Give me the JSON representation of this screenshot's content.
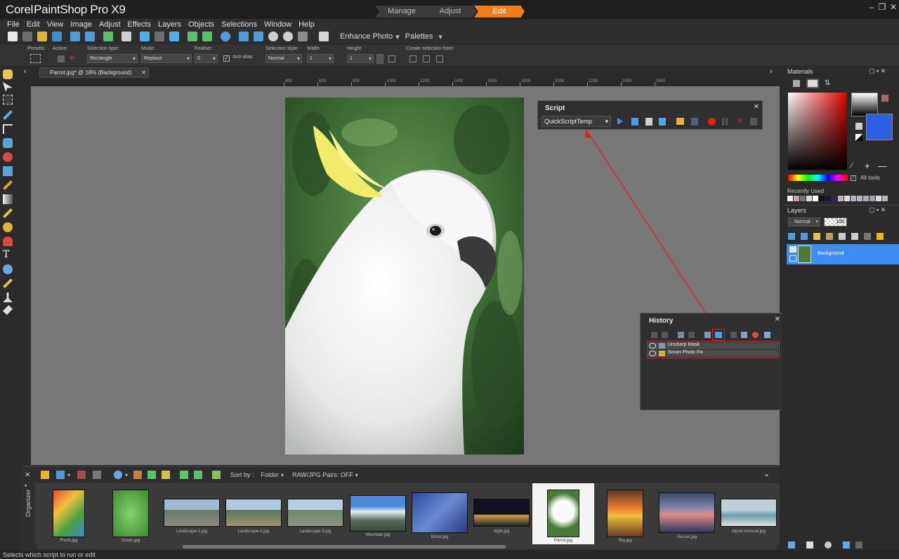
{
  "app": {
    "title_plain": "Corel",
    "title_rest": "PaintShop Pro X9"
  },
  "workspace_tabs": [
    "Manage",
    "Adjust",
    "Edit"
  ],
  "menu": [
    "File",
    "Edit",
    "View",
    "Image",
    "Adjust",
    "Effects",
    "Layers",
    "Objects",
    "Selections",
    "Window",
    "Help"
  ],
  "toolbar": {
    "enhance_label": "Enhance Photo",
    "palettes_label": "Palettes"
  },
  "options": {
    "presets_label": "Presets:",
    "action_label": "Action:",
    "selection_type_label": "Selection type:",
    "selection_type_value": "Rectangle",
    "mode_label": "Mode:",
    "mode_value": "Replace",
    "feather_label": "Feather:",
    "feather_value": "0",
    "antialias_label": "Anti-alias",
    "selection_style_label": "Selection style:",
    "selection_style_value": "Normal",
    "width_label": "Width",
    "width_value": "1",
    "height_label": "Height",
    "height_value": "1",
    "create_from_label": "Create selection from:"
  },
  "document": {
    "tab_label": "Parrot.jpg* @  18% (Background)"
  },
  "ruler_ticks": [
    "200",
    "400",
    "600",
    "800",
    "1000",
    "1200",
    "1400",
    "1600",
    "1800",
    "2000",
    "2200",
    "2400",
    "2600"
  ],
  "script_palette": {
    "title": "Script",
    "script_name": "QuickScriptTemp"
  },
  "history": {
    "title": "History",
    "items": [
      "Unsharp Mask",
      "Smart Photo Fix"
    ]
  },
  "materials": {
    "title": "Materials",
    "all_tools_label": "All tools",
    "recently_used_label": "Recently Used"
  },
  "layers": {
    "title": "Layers",
    "blend_mode": "Normal",
    "opacity": "100",
    "layer_name": "Background"
  },
  "organizer": {
    "label": "Organizer",
    "sort_by_label": "Sort by :",
    "sort_by_value": "Folder",
    "raw_pairs_label": "RAW/JPG Pairs: OFF",
    "thumbnails": [
      "Fresh.jpg",
      "Green.jpg",
      "Landscape-1.jpg",
      "Landscape-2.jpg",
      "Landscape-3.jpg",
      "Mountain.jpg",
      "Mural.jpg",
      "night.jpg",
      "Parrot.jpg",
      "Sky.jpg",
      "Sunset.jpg",
      "tripod removal.jpg"
    ]
  },
  "status": "Selects which script to run or edit",
  "colors": {
    "accent_orange": "#f07d1a",
    "highlight_blue": "#3d8ef0",
    "record_red": "#e02020",
    "annotation_red": "#e02020"
  }
}
